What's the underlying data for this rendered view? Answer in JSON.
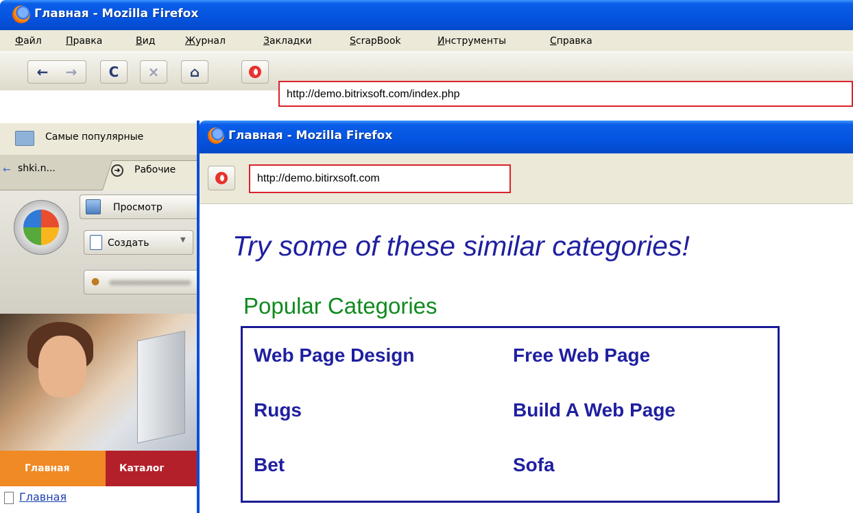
{
  "back_window": {
    "title": "Главная - Mozilla Firefox",
    "menu": [
      "Файл",
      "Правка",
      "Вид",
      "Журнал",
      "Закладки",
      "ScrapBook",
      "Инструменты",
      "Справка"
    ],
    "nav": {
      "back_icon": "back-arrow-icon",
      "forward_icon": "forward-arrow-icon",
      "reload_icon": "reload-icon",
      "stop_icon": "stop-icon",
      "home_icon": "home-icon"
    },
    "url": "http://demo.bitrixsoft.com/index.php",
    "bookmarks_label": "Самые популярные",
    "tabs": [
      "shki.n...",
      "Рабочие"
    ],
    "panel": {
      "view_label": "Просмотр",
      "create_label": "Создать"
    },
    "site_tabs": [
      "Главная",
      "Каталог"
    ],
    "site_link": "Главная"
  },
  "front_window": {
    "title": "Главная - Mozilla Firefox",
    "url": "http://demo.bitirxsoft.com",
    "headline": "Try some of these similar categories!",
    "categories_title": "Popular Categories",
    "categories": [
      [
        "Web Page Design",
        "Free Web Page"
      ],
      [
        "Rugs",
        "Build A Web Page"
      ],
      [
        "Bet",
        "Sofa"
      ]
    ]
  },
  "colors": {
    "xp_blue": "#0553e0",
    "highlight_red": "#d9222a",
    "link_blue": "#1f1fa0",
    "category_green": "#0f8a1e",
    "site_orange": "#f08a24",
    "site_red": "#b4202a"
  }
}
